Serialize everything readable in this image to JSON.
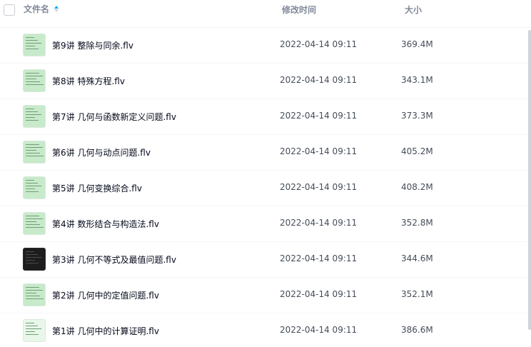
{
  "header": {
    "name_label": "文件名",
    "time_label": "修改时间",
    "size_label": "大小"
  },
  "files": [
    {
      "name": "第9讲 整除与同余.flv",
      "modified": "2022-04-14 09:11",
      "size": "369.4M",
      "thumb": "green-doc"
    },
    {
      "name": "第8讲 特殊方程.flv",
      "modified": "2022-04-14 09:11",
      "size": "343.1M",
      "thumb": "green-doc"
    },
    {
      "name": "第7讲 几何与函数新定义问题.flv",
      "modified": "2022-04-14 09:11",
      "size": "373.3M",
      "thumb": "green-doc"
    },
    {
      "name": "第6讲 几何与动点问题.flv",
      "modified": "2022-04-14 09:11",
      "size": "405.2M",
      "thumb": "green-doc"
    },
    {
      "name": "第5讲 几何变换综合.flv",
      "modified": "2022-04-14 09:11",
      "size": "408.2M",
      "thumb": "green-doc"
    },
    {
      "name": "第4讲 数形结合与构造法.flv",
      "modified": "2022-04-14 09:11",
      "size": "352.8M",
      "thumb": "green-doc"
    },
    {
      "name": "第3讲 几何不等式及最值问题.flv",
      "modified": "2022-04-14 09:11",
      "size": "344.6M",
      "thumb": "dark"
    },
    {
      "name": "第2讲 几何中的定值问题.flv",
      "modified": "2022-04-14 09:11",
      "size": "352.1M",
      "thumb": "green-doc"
    },
    {
      "name": "第1讲 几何中的计算证明.flv",
      "modified": "2022-04-14 09:11",
      "size": "386.6M",
      "thumb": "white-doc"
    }
  ]
}
